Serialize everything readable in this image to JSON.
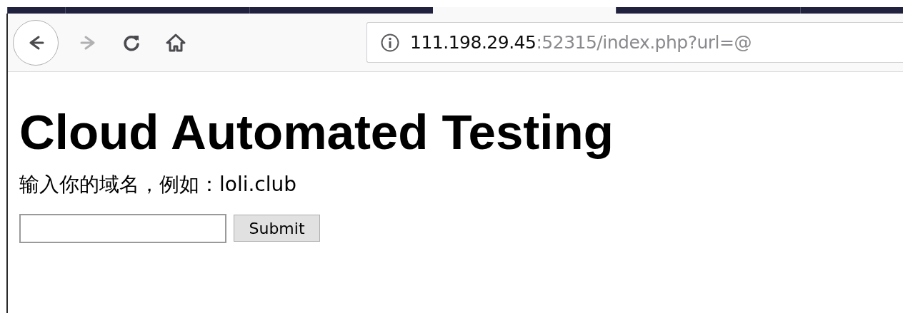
{
  "tabs": [
    {
      "selected": false
    },
    {
      "selected": false
    },
    {
      "selected": false
    },
    {
      "selected": true
    },
    {
      "selected": false
    },
    {
      "selected": false
    }
  ],
  "nav_buttons": [
    {
      "kind": "back",
      "disabled": false
    },
    {
      "kind": "forward",
      "disabled": true
    },
    {
      "kind": "reload",
      "disabled": false
    },
    {
      "kind": "home",
      "disabled": false
    }
  ],
  "address_bar": {
    "host": "111.198.29.45",
    "rest": ":52315/index.php?url=@"
  },
  "page": {
    "heading": "Cloud Automated Testing",
    "prompt": "输入你的域名，例如：loli.club",
    "button": "Submit"
  }
}
